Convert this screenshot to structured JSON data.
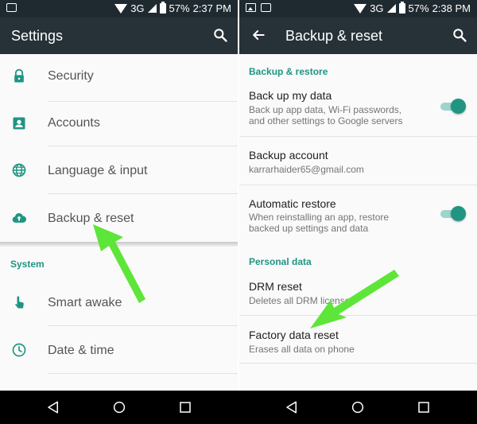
{
  "left": {
    "status": {
      "network": "3G",
      "battery": "57%",
      "time": "2:37 PM"
    },
    "appbar": {
      "title": "Settings",
      "search_icon": "search-icon"
    },
    "items": [
      {
        "label": "Security",
        "icon": "lock-icon"
      },
      {
        "label": "Accounts",
        "icon": "account-box-icon"
      },
      {
        "label": "Language & input",
        "icon": "globe-icon"
      },
      {
        "label": "Backup & reset",
        "icon": "cloud-upload-icon"
      }
    ],
    "section": "System",
    "system_items": [
      {
        "label": "Smart awake",
        "icon": "touch-hand-icon"
      },
      {
        "label": "Date & time",
        "icon": "clock-icon"
      }
    ]
  },
  "right": {
    "status": {
      "network": "3G",
      "battery": "57%",
      "time": "2:38 PM"
    },
    "appbar": {
      "title": "Backup & reset",
      "back_icon": "back-arrow-icon",
      "search_icon": "search-icon"
    },
    "section1": "Backup & restore",
    "backup_my_data": {
      "title": "Back up my data",
      "summary": "Back up app data, Wi-Fi passwords, and other settings to Google servers",
      "enabled": true
    },
    "backup_account": {
      "title": "Backup account",
      "summary": "karrarhaider65@gmail.com"
    },
    "automatic_restore": {
      "title": "Automatic restore",
      "summary": "When reinstalling an app, restore backed up settings and data",
      "enabled": true
    },
    "section2": "Personal data",
    "drm_reset": {
      "title": "DRM reset",
      "summary": "Deletes all DRM licenses"
    },
    "factory_reset": {
      "title": "Factory data reset",
      "summary": "Erases all data on phone"
    }
  },
  "colors": {
    "accent": "#1f9582",
    "appbar": "#263238",
    "statusbar": "#1f2a30",
    "arrow": "#5ee53a"
  },
  "navbar": {
    "icons": [
      "back-triangle-icon",
      "home-circle-icon",
      "recents-square-icon"
    ]
  }
}
